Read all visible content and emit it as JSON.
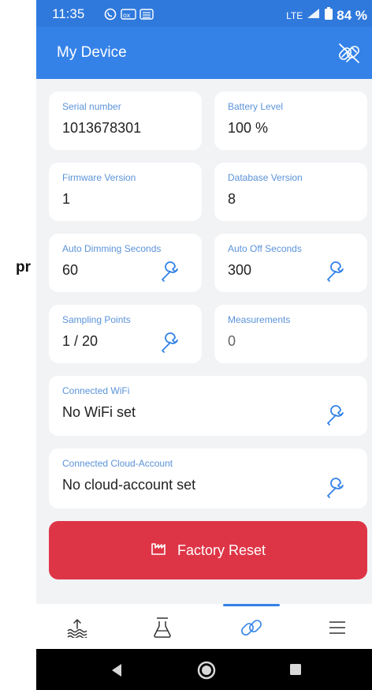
{
  "side_text": "pr",
  "status": {
    "time": "11:35",
    "network": "LTE",
    "battery": "84 %"
  },
  "header": {
    "title": "My Device",
    "unlink_icon": "link-off-icon"
  },
  "cards": {
    "serial": {
      "label": "Serial number",
      "value": "1013678301"
    },
    "battery": {
      "label": "Battery Level",
      "value": "100 %"
    },
    "firmware": {
      "label": "Firmware Version",
      "value": "1"
    },
    "database": {
      "label": "Database Version",
      "value": "8"
    },
    "auto_dim": {
      "label": "Auto Dimming Seconds",
      "value": "60"
    },
    "auto_off": {
      "label": "Auto Off Seconds",
      "value": "300"
    },
    "sampling": {
      "label": "Sampling Points",
      "value": "1 / 20"
    },
    "measurements": {
      "label": "Measurements",
      "value": "0"
    },
    "wifi": {
      "label": "Connected WiFi",
      "value": "No WiFi set"
    },
    "cloud": {
      "label": "Connected Cloud-Account",
      "value": "No cloud-account set"
    }
  },
  "factory_reset": {
    "label": "Factory Reset",
    "icon": "factory-icon"
  },
  "nav": {
    "items": [
      "water-level-icon",
      "flask-icon",
      "link-icon",
      "menu-icon"
    ],
    "active": "link-icon"
  },
  "colors": {
    "primary": "#3482e8",
    "danger": "#de3546",
    "label": "#5b93d9",
    "background": "#f1f3f5"
  }
}
